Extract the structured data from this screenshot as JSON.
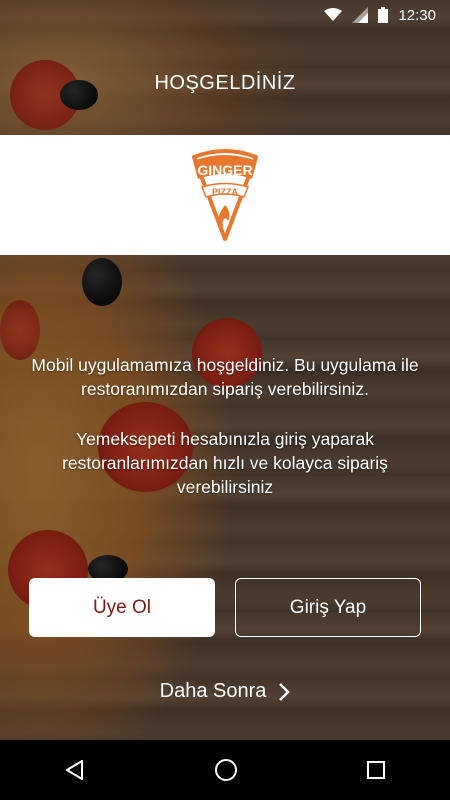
{
  "status_bar": {
    "time": "12:30",
    "icons": [
      "wifi-icon",
      "signal-icon",
      "battery-icon"
    ]
  },
  "header": {
    "title": "HOŞGELDİNİZ"
  },
  "logo": {
    "line1": "GINGER",
    "line2": "PIZZA",
    "icon": "flame-icon",
    "brand_color": "#e8772e"
  },
  "welcome_text": "Mobil uygulamamıza hoşgeldiniz. Bu uygulama ile restoranımızdan sipariş verebilirsiniz.",
  "login_hint": "Yemeksepeti hesabınızla giriş yaparak restoranlarımızdan hızlı ve kolayca sipariş verebilirsiniz",
  "buttons": {
    "signup": "Üye Ol",
    "login": "Giriş Yap"
  },
  "later": {
    "label": "Daha Sonra",
    "icon": "chevron-right-icon"
  },
  "nav": {
    "icons": [
      "back-icon",
      "home-icon",
      "recents-icon"
    ]
  },
  "colors": {
    "signup_text": "#7a1a12",
    "logo_orange": "#e8772e"
  }
}
